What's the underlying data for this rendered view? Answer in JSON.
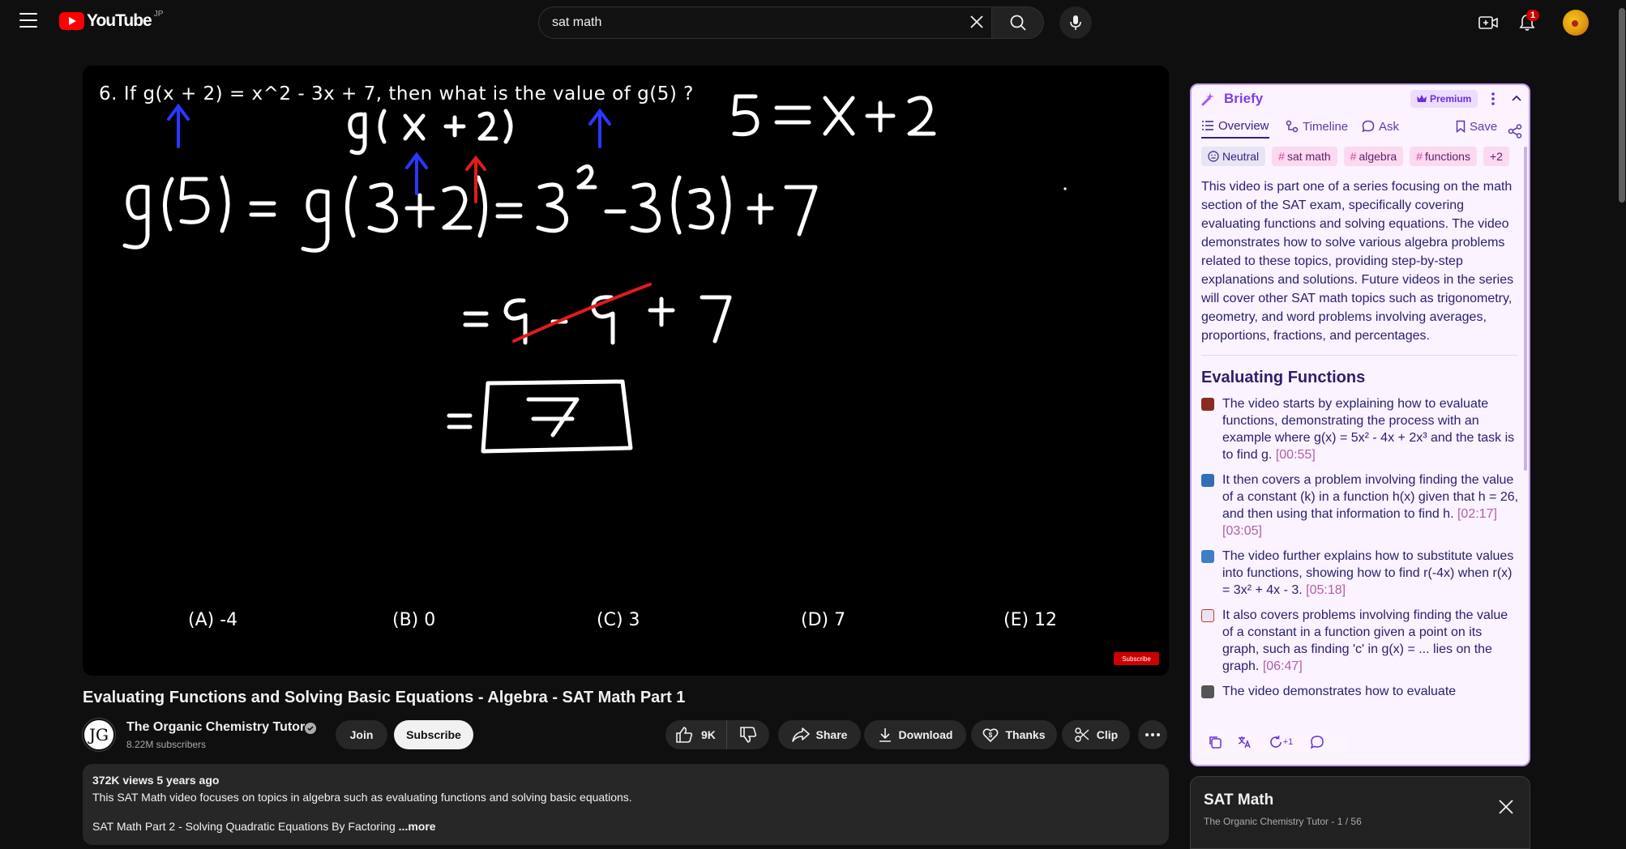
{
  "header": {
    "logo_text": "YouTube",
    "region": "JP",
    "search_value": "sat math",
    "notification_count": "1"
  },
  "video": {
    "question": "6.  If g(x + 2) = x^2 - 3x + 7, then what is the value of g(5) ?",
    "choices": [
      "(A)  -4",
      "(B)  0",
      "(C)  3",
      "(D)  7",
      "(E)  12"
    ],
    "watermark": "Subscribe"
  },
  "meta": {
    "title": "Evaluating Functions and Solving Basic Equations - Algebra - SAT Math Part 1",
    "channel_initials": "JG",
    "channel_name": "The Organic Chemistry Tutor",
    "subscribers": "8.22M subscribers",
    "join_label": "Join",
    "subscribe_label": "Subscribe",
    "likes": "9K",
    "share_label": "Share",
    "download_label": "Download",
    "thanks_label": "Thanks",
    "clip_label": "Clip"
  },
  "description": {
    "stats": "372K views  5 years ago",
    "line1": "This SAT Math video focuses on topics in algebra such as evaluating functions and solving basic equations.",
    "line3": "SAT Math Part 2 - Solving Quadratic Equations By Factoring",
    "more_label": "...more"
  },
  "briefy": {
    "title": "Briefy",
    "premium_label": "Premium",
    "tabs": {
      "overview": "Overview",
      "timeline": "Timeline",
      "ask": "Ask",
      "save": "Save"
    },
    "chips": {
      "neutral": "Neutral",
      "tag1": "sat math",
      "tag2": "algebra",
      "tag3": "functions",
      "more": "+2"
    },
    "summary": "This video is part one of a series focusing on the math section of the SAT exam, specifically covering evaluating functions and solving equations. The video demonstrates how to solve various algebra problems related to these topics, providing step-by-step explanations and solutions. Future videos in the series will cover other SAT math topics such as trigonometry, geometry, and word problems involving averages, proportions, fractions, and percentages.",
    "section_title": "Evaluating Functions",
    "bullets": [
      {
        "text": "The video starts by explaining how to evaluate functions, demonstrating the process with an example where g(x) = 5x² - 4x + 2x³ and the task is to find g.",
        "ts": "[00:55]"
      },
      {
        "text": "It then covers a problem involving finding the value of a constant (k) in a function h(x) given that h = 26, and then using that information to find h.",
        "ts": "[02:17][03:05]"
      },
      {
        "text": "The video further explains how to substitute values into functions, showing how to find r(-4x) when r(x) = 3x² + 4x - 3.",
        "ts": "[05:18]"
      },
      {
        "text": "It also covers problems involving finding the value of a constant in a function given a point on its graph, such as finding 'c' in g(x) = ... lies on the graph.",
        "ts": "[06:47]"
      },
      {
        "text": "The video demonstrates how to evaluate",
        "ts": ""
      }
    ],
    "toolbar_counter": "+1",
    "colors": {
      "accent": "#7b3fe4",
      "border": "#c39bf0",
      "background": "#fbf3ff"
    }
  },
  "playlist": {
    "title": "SAT Math",
    "subtitle": "The Organic Chemistry Tutor - 1 / 56"
  }
}
